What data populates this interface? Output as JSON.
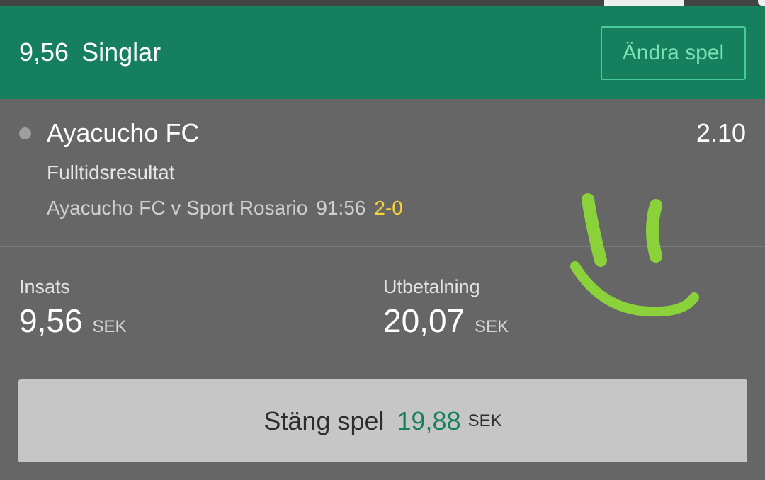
{
  "header": {
    "stake": "9,56",
    "bet_type": "Singlar",
    "edit_button": "Ändra spel"
  },
  "selection": {
    "team": "Ayacucho FC",
    "odds": "2.10",
    "market": "Fulltidsresultat",
    "event": "Ayacucho FC v Sport Rosario",
    "match_time": "91:56",
    "score": "2-0"
  },
  "stats": {
    "stake_label": "Insats",
    "stake_value": "9,56",
    "stake_currency": "SEK",
    "payout_label": "Utbetalning",
    "payout_value": "20,07",
    "payout_currency": "SEK"
  },
  "cashout": {
    "label": "Stäng spel",
    "amount": "19,88",
    "currency": "SEK"
  },
  "colors": {
    "header_green": "#157f5e",
    "edit_border": "#4bc999",
    "score_yellow": "#f5d13b",
    "smiley_stroke": "#8bd23a"
  }
}
